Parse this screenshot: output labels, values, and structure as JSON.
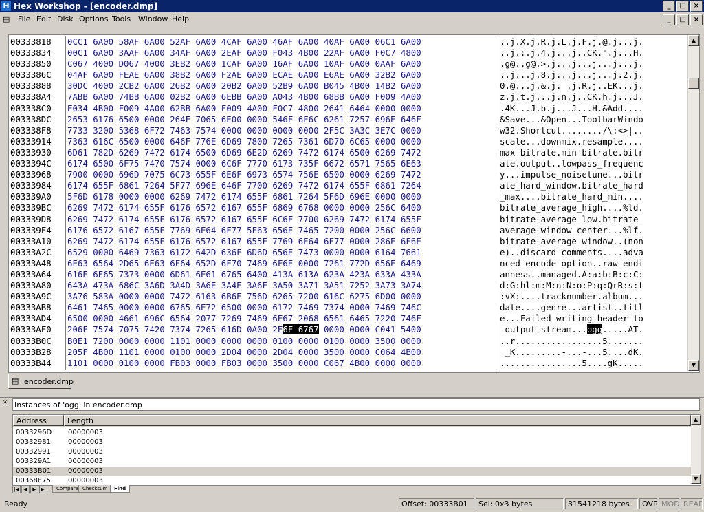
{
  "app": {
    "title": "Hex Workshop - [encoder.dmp]",
    "icon": "hex-workshop-icon",
    "window_buttons": [
      "_",
      "□",
      "×"
    ]
  },
  "menu": [
    "File",
    "Edit",
    "Disk",
    "Options",
    "Tools",
    "Window",
    "Help"
  ],
  "hex_view": {
    "rows": [
      {
        "addr": "00333818",
        "hex": "0CC1 6A00 58AF 6A00 52AF 6A00 4CAF 6A00 46AF 6A00 40AF 6A00 06C1 6A00",
        "ascii": "..j.X.j.R.j.L.j.F.j.@.j...j."
      },
      {
        "addr": "00333834",
        "hex": "00C1 6A00 3AAF 6A00 34AF 6A00 2EAF 6A00 F043 4B00 22AF 6A00 F0C7 4800",
        "ascii": "..j.:.j.4.j...j..CK.\".j...H."
      },
      {
        "addr": "00333850",
        "hex": "C067 4000 D067 4000 3EB2 6A00 1CAF 6A00 16AF 6A00 10AF 6A00 0AAF 6A00",
        "ascii": ".g@..g@.>.j...j...j...j...j."
      },
      {
        "addr": "0033386C",
        "hex": "04AF 6A00 FEAE 6A00 38B2 6A00 F2AE 6A00 ECAE 6A00 E6AE 6A00 32B2 6A00",
        "ascii": "..j...j.8.j...j...j...j.2.j."
      },
      {
        "addr": "00333888",
        "hex": "30DC 4000 2CB2 6A00 26B2 6A00 20B2 6A00 52B9 6A00 B045 4B00 14B2 6A00",
        "ascii": "0.@.,.j.&.j. .j.R.j..EK...j."
      },
      {
        "addr": "003338A4",
        "hex": "7ABB 6A00 74BB 6A00 02B2 6A00 6EBB 6A00 A043 4B00 68BB 6A00 F009 4A00",
        "ascii": "z.j.t.j...j.n.j..CK.h.j...J."
      },
      {
        "addr": "003338C0",
        "hex": "E034 4B00 F009 4A00 62BB 6A00 F009 4A00 F0C7 4800 2641 6464 0000 0000",
        "ascii": ".4K...J.b.j...J...H.&Add...."
      },
      {
        "addr": "003338DC",
        "hex": "2653 6176 6500 0000 264F 7065 6E00 0000 546F 6F6C 6261 7257 696E 646F",
        "ascii": "&Save...&Open...ToolbarWindo"
      },
      {
        "addr": "003338F8",
        "hex": "7733 3200 5368 6F72 7463 7574 0000 0000 0000 0000 2F5C 3A3C 3E7C 0000",
        "ascii": "w32.Shortcut......../\\:<>|.."
      },
      {
        "addr": "00333914",
        "hex": "7363 616C 6500 0000 646F 776E 6D69 7800 7265 7361 6D70 6C65 0000 0000",
        "ascii": "scale...downmix.resample...."
      },
      {
        "addr": "00333930",
        "hex": "6D61 782D 6269 7472 6174 6500 6D69 6E2D 6269 7472 6174 6500 6269 7472",
        "ascii": "max-bitrate.min-bitrate.bitr"
      },
      {
        "addr": "0033394C",
        "hex": "6174 6500 6F75 7470 7574 0000 6C6F 7770 6173 735F 6672 6571 7565 6E63",
        "ascii": "ate.output..lowpass_frequenc"
      },
      {
        "addr": "00333968",
        "hex": "7900 0000 696D 7075 6C73 655F 6E6F 6973 6574 756E 6500 0000 6269 7472",
        "ascii": "y...impulse_noisetune...bitr"
      },
      {
        "addr": "00333984",
        "hex": "6174 655F 6861 7264 5F77 696E 646F 7700 6269 7472 6174 655F 6861 7264",
        "ascii": "ate_hard_window.bitrate_hard"
      },
      {
        "addr": "003339A0",
        "hex": "5F6D 6178 0000 0000 6269 7472 6174 655F 6861 7264 5F6D 696E 0000 0000",
        "ascii": "_max....bitrate_hard_min...."
      },
      {
        "addr": "003339BC",
        "hex": "6269 7472 6174 655F 6176 6572 6167 655F 6869 6768 0000 0000 256C 6400",
        "ascii": "bitrate_average_high....%ld."
      },
      {
        "addr": "003339D8",
        "hex": "6269 7472 6174 655F 6176 6572 6167 655F 6C6F 7700 6269 7472 6174 655F",
        "ascii": "bitrate_average_low.bitrate_"
      },
      {
        "addr": "003339F4",
        "hex": "6176 6572 6167 655F 7769 6E64 6F77 5F63 656E 7465 7200 0000 256C 6600",
        "ascii": "average_window_center...%lf."
      },
      {
        "addr": "00333A10",
        "hex": "6269 7472 6174 655F 6176 6572 6167 655F 7769 6E64 6F77 0000 286E 6F6E",
        "ascii": "bitrate_average_window..(non"
      },
      {
        "addr": "00333A2C",
        "hex": "6529 0000 6469 7363 6172 642D 636F 6D6D 656E 7473 0000 0000 6164 7661",
        "ascii": "e)..discard-comments....adva"
      },
      {
        "addr": "00333A48",
        "hex": "6E63 6564 2D65 6E63 6F64 652D 6F70 7469 6F6E 0000 7261 772D 656E 6469",
        "ascii": "nced-encode-option..raw-endi"
      },
      {
        "addr": "00333A64",
        "hex": "616E 6E65 7373 0000 6D61 6E61 6765 6400 413A 613A 623A 423A 633A 433A",
        "ascii": "anness..managed.A:a:b:B:c:C:"
      },
      {
        "addr": "00333A80",
        "hex": "643A 473A 686C 3A6D 3A4D 3A6E 3A4E 3A6F 3A50 3A71 3A51 7252 3A73 3A74",
        "ascii": "d:G:hl:m:M:n:N:o:P:q:QrR:s:t"
      },
      {
        "addr": "00333A9C",
        "hex": "3A76 583A 0000 0000 7472 6163 6B6E 756D 6265 7200 616C 6275 6D00 0000",
        "ascii": ":vX:....tracknumber.album..."
      },
      {
        "addr": "00333AB8",
        "hex": "6461 7465 0000 0000 6765 6E72 6500 0000 6172 7469 7374 0000 7469 746C",
        "ascii": "date....genre...artist..titl"
      },
      {
        "addr": "00333AD4",
        "hex": "6500 0000 4661 696C 6564 2077 7269 7469 6E67 2068 6561 6465 7220 746F",
        "ascii": "e...Failed writing header to"
      },
      {
        "addr": "00333AF0",
        "hex": "206F 7574 7075 7420 7374 7265 616D 0A00 2E",
        "hex_hl": "6F 6767",
        "hex_rest": " 0000 0000 C041 5400",
        "ascii": " output stream...",
        "ascii_hl": "ogg",
        "ascii_rest": ".....AT."
      },
      {
        "addr": "00333B0C",
        "hex": "B0E1 7200 0000 0000 1101 0000 0000 0000 0100 0000 0100 0000 3500 0000",
        "ascii": "..r.................5......."
      },
      {
        "addr": "00333B28",
        "hex": "205F 4B00 1101 0000 0100 0000 2D04 0000 2D04 0000 3500 0000 C064 4B00",
        "ascii": " _K.........-...-...5....dK."
      },
      {
        "addr": "00333B44",
        "hex": "1101 0000 0100 0000 FB03 0000 FB03 0000 3500 0000 C067 4B00 0000 0000",
        "ascii": "................5....gK....."
      }
    ]
  },
  "doc_tab": {
    "label": "encoder.dmp",
    "icon": "document-icon"
  },
  "results_panel": {
    "heading": "Instances of 'ogg' in encoder.dmp",
    "columns": [
      "Address",
      "Length"
    ],
    "rows": [
      {
        "address": "0033296D",
        "length": "00000003"
      },
      {
        "address": "00332981",
        "length": "00000003"
      },
      {
        "address": "00332991",
        "length": "00000003"
      },
      {
        "address": "003329A1",
        "length": "00000003"
      },
      {
        "address": "00333B01",
        "length": "00000003",
        "selected": true
      },
      {
        "address": "00368E75",
        "length": "00000003"
      }
    ],
    "tabs": [
      "Compare",
      "Checksum",
      "Find"
    ],
    "active_tab": "Find"
  },
  "status": {
    "ready": "Ready",
    "offset": "Offset: 00333B01",
    "selection": "Sel: 0x3 bytes",
    "size": "31541218 bytes",
    "ovr": "OVR",
    "mod": "MOD",
    "read": "READ"
  },
  "colors": {
    "titlebar": "#0a246a",
    "hex_text": "#1a1a8c",
    "highlight": "#000000",
    "chrome": "#d4d0c8"
  }
}
